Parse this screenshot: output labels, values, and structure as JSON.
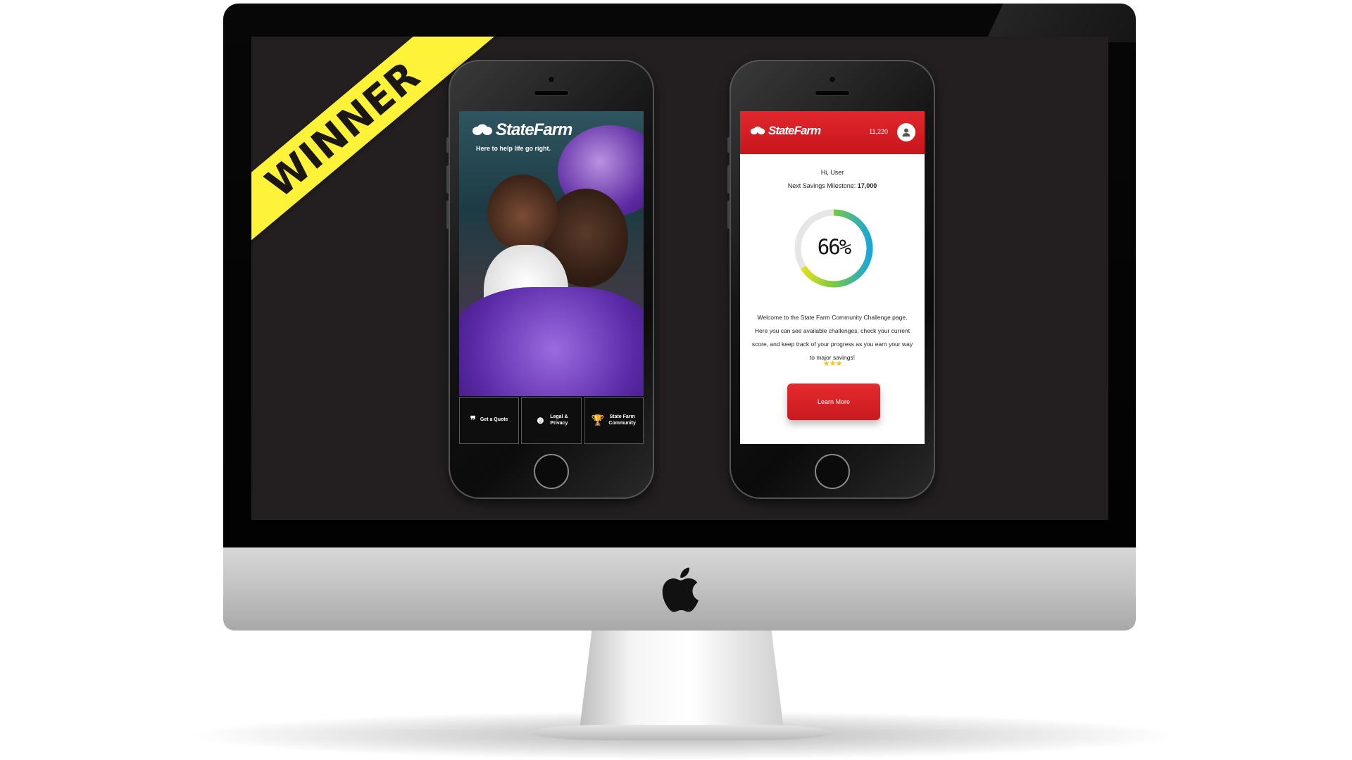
{
  "ribbon": {
    "label": "WINNER"
  },
  "phone_one": {
    "brand": "StateFarm",
    "tagline": "Here to help life go right.",
    "tiles": [
      {
        "label_lines": [
          "Get a Quote"
        ],
        "icon": "quote-icon"
      },
      {
        "label_lines": [
          "Legal &",
          "Privacy"
        ],
        "icon": "user-shield-icon"
      },
      {
        "label_lines": [
          "State Farm",
          "Community"
        ],
        "icon": "trophy-icon"
      }
    ]
  },
  "phone_two": {
    "brand": "StateFarm",
    "points": "11,220",
    "greeting": "Hi, User",
    "milestone_label": "Next Savings Milestone:",
    "milestone_value": "17,000",
    "progress_percent": 66,
    "progress_text": "66%",
    "welcome_text": "Welcome to the State Farm Community Challenge page. Here you can see available challenges, check your current score, and keep track of your progress as you earn your way to major savings!",
    "stars": 3,
    "cta_label": "Learn More"
  },
  "colors": {
    "brand_red": "#d81e24",
    "ribbon_yellow": "#fff33a",
    "screen_bg": "#231f20",
    "ring_start": "#f4e21a",
    "ring_mid": "#7ac943",
    "ring_end": "#1aa6d8",
    "ring_track": "#e6e6e6"
  }
}
